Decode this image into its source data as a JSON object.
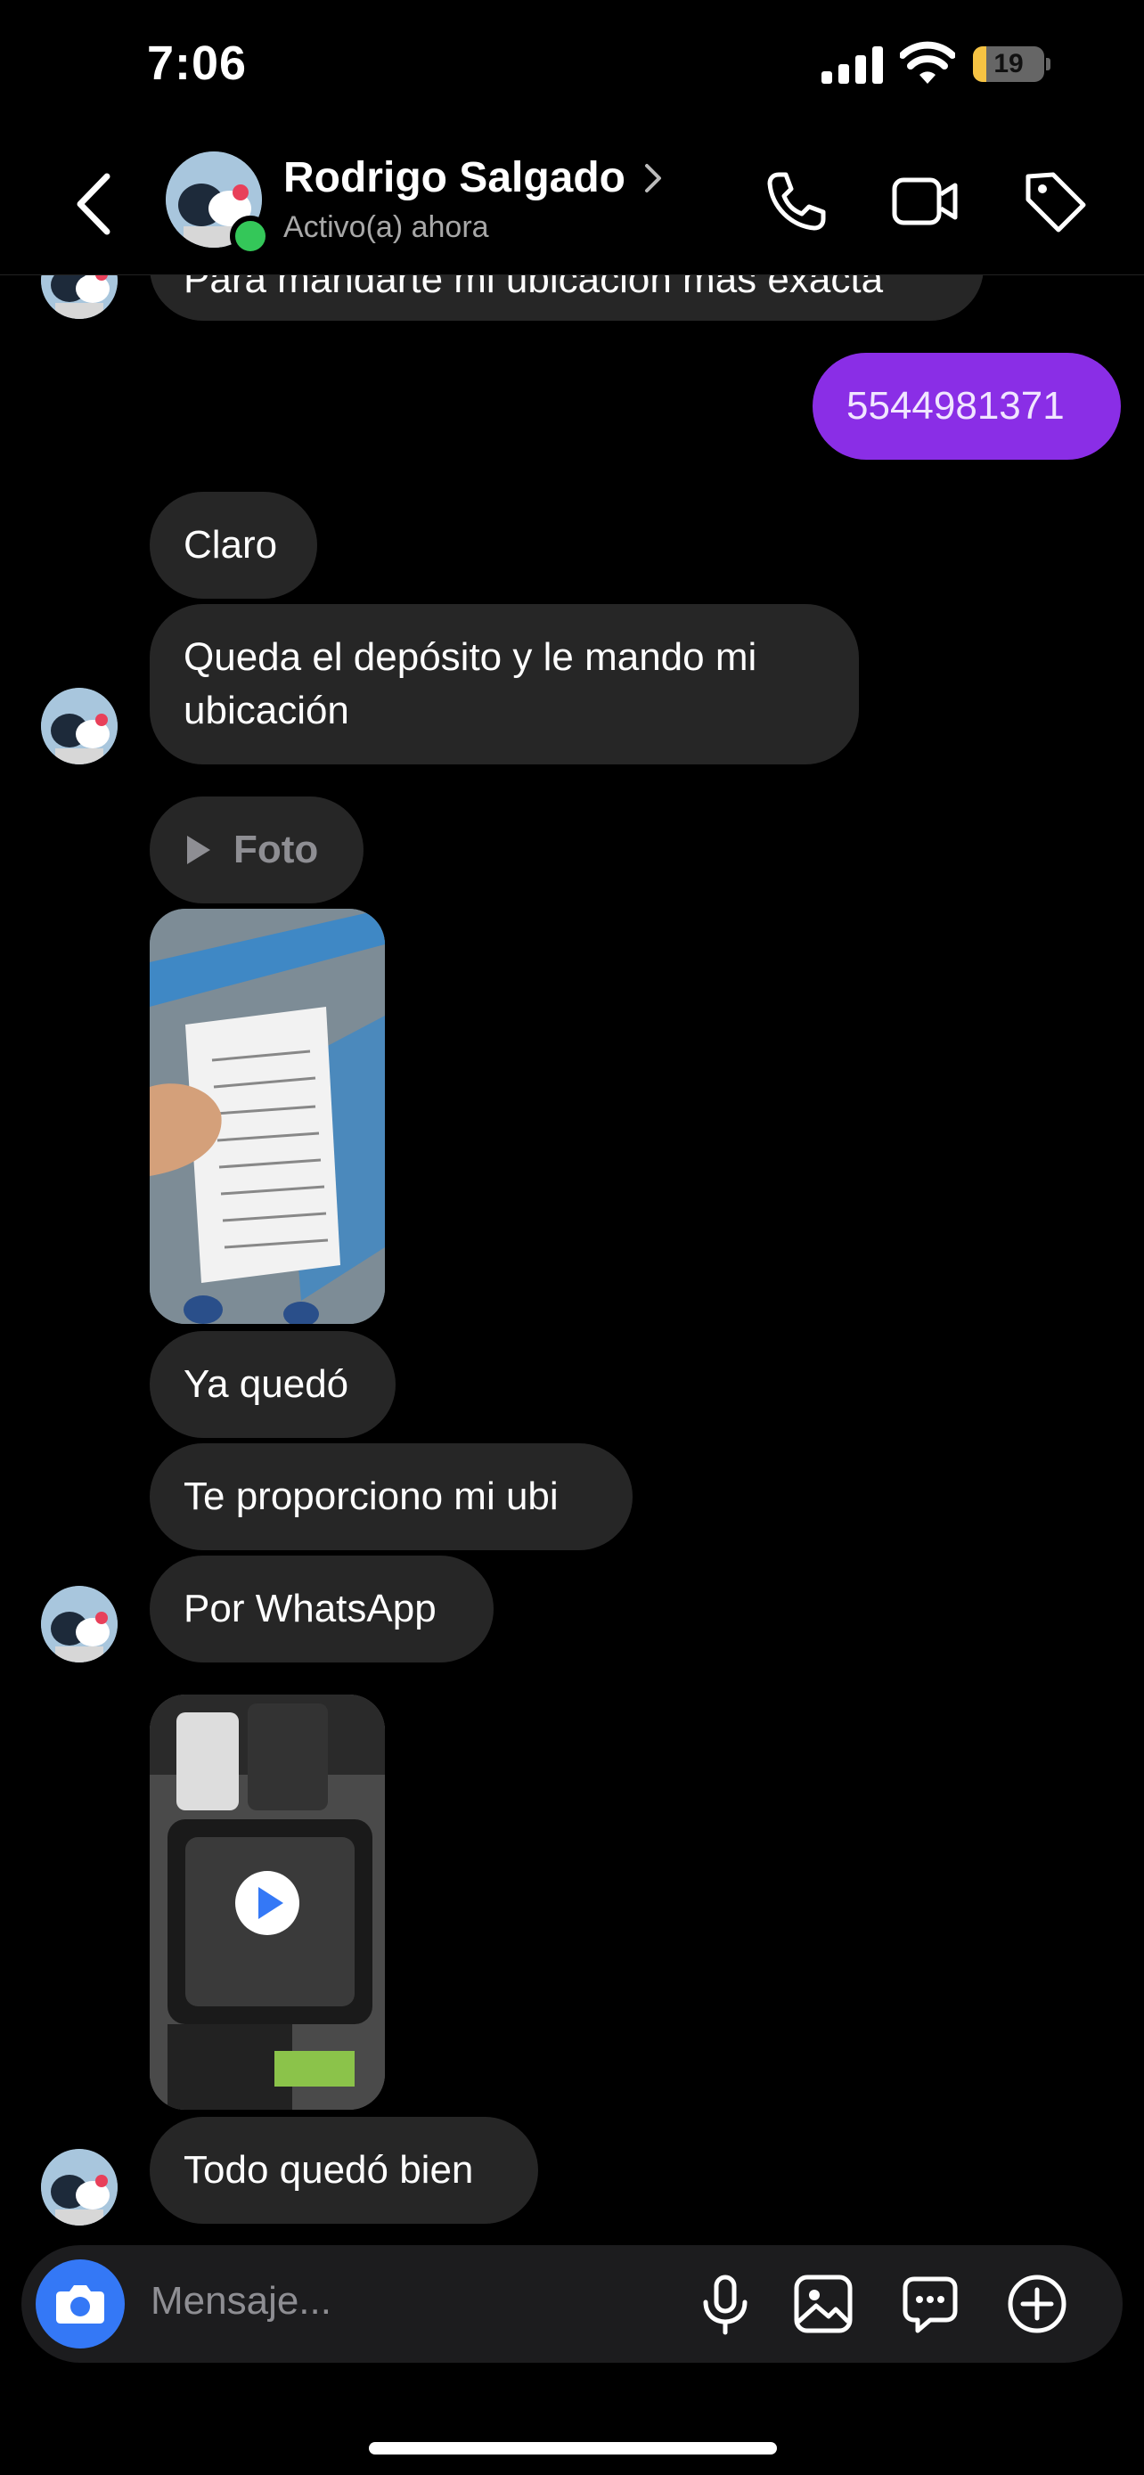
{
  "status_bar": {
    "time": "7:06",
    "battery": "19",
    "battery_level": 0.19
  },
  "header": {
    "contact_name": "Rodrigo Salgado",
    "contact_status": "Activo(a) ahora",
    "icons": [
      "back-icon",
      "phone-icon",
      "video-camera-icon",
      "tag-icon"
    ]
  },
  "messages": [
    {
      "type": "text",
      "from": "them",
      "text": "Para mandarte mi ubicación más exacta"
    },
    {
      "type": "text",
      "from": "me",
      "text": "5544981371"
    },
    {
      "type": "text",
      "from": "them",
      "text": "Claro"
    },
    {
      "type": "text",
      "from": "them",
      "text": "Queda el depósito y le mando mi ubicación"
    },
    {
      "type": "text",
      "from": "them",
      "text": "Foto",
      "icon": "play-icon"
    },
    {
      "type": "image",
      "from": "them"
    },
    {
      "type": "text",
      "from": "them",
      "text": "Ya quedó"
    },
    {
      "type": "text",
      "from": "them",
      "text": "Te proporciono mi ubi"
    },
    {
      "type": "text",
      "from": "them",
      "text": "Por WhatsApp"
    },
    {
      "type": "video",
      "from": "them"
    },
    {
      "type": "text",
      "from": "them",
      "text": "Todo quedó bien"
    }
  ],
  "composer": {
    "placeholder": "Mensaje...",
    "icons": [
      "camera-icon",
      "microphone-icon",
      "gallery-icon",
      "sticker-icon",
      "plus-icon"
    ]
  },
  "colors": {
    "sent_bubble": "#8a2ee6",
    "received_bubble": "#262626",
    "online": "#34c759",
    "camera_button": "#3478f6"
  }
}
